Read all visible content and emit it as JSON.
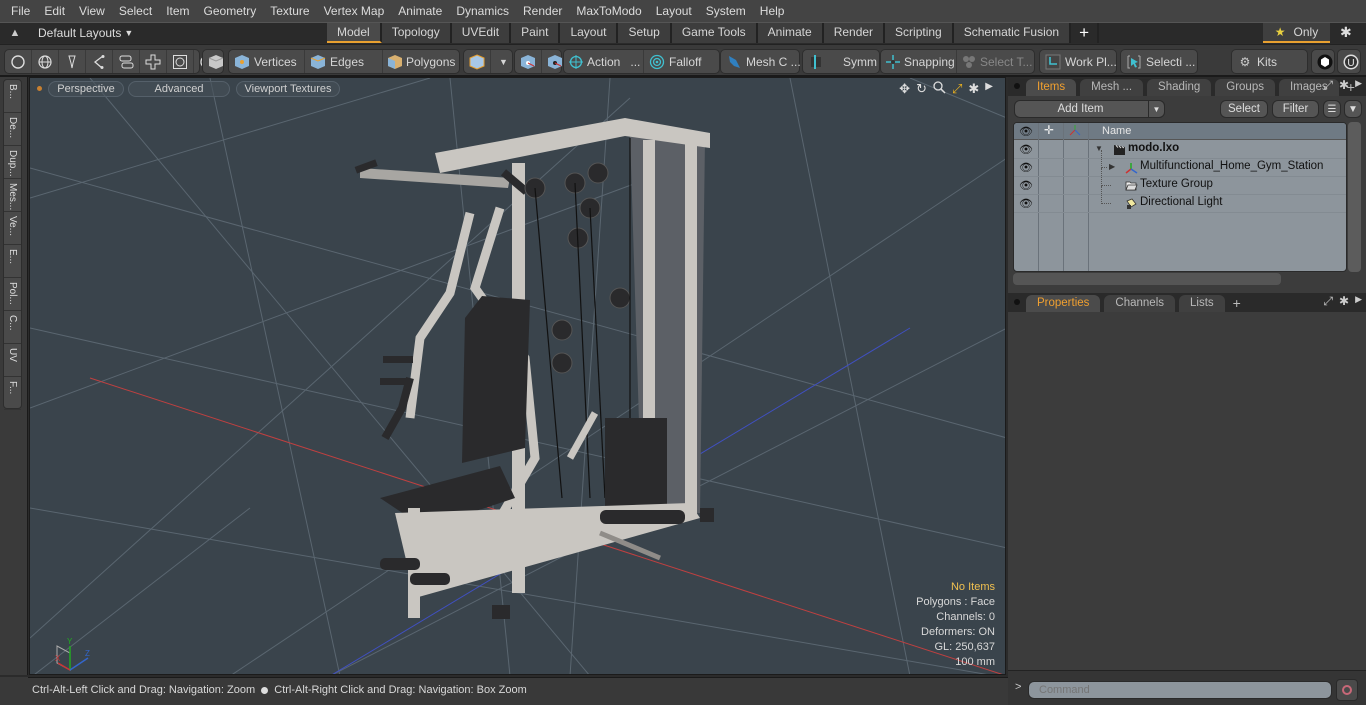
{
  "menubar": {
    "items": [
      "File",
      "Edit",
      "View",
      "Select",
      "Item",
      "Geometry",
      "Texture",
      "Vertex Map",
      "Animate",
      "Dynamics",
      "Render",
      "MaxToModo",
      "Layout",
      "System",
      "Help"
    ]
  },
  "layout_row": {
    "layout_label": "Default Layouts",
    "tabs": [
      {
        "label": "Model",
        "active": true
      },
      {
        "label": "Topology"
      },
      {
        "label": "UVEdit"
      },
      {
        "label": "Paint"
      },
      {
        "label": "Layout"
      },
      {
        "label": "Setup"
      },
      {
        "label": "Game Tools"
      },
      {
        "label": "Animate"
      },
      {
        "label": "Render"
      },
      {
        "label": "Scripting"
      },
      {
        "label": "Schematic Fusion"
      }
    ],
    "add_tab": "+",
    "only_label": "Only"
  },
  "toolbar": {
    "vertices": "Vertices",
    "edges": "Edges",
    "polygons": "Polygons",
    "action": "Action",
    "falloff": "Falloff",
    "mesh_c": "Mesh C ...",
    "symm": "Symm ...",
    "snapping": "Snapping",
    "select_t": "Select T...",
    "work_pl": "Work Pl...",
    "selecti": "Selecti ...",
    "kits": "Kits",
    "ellipsis": "..."
  },
  "left_tabs": [
    "B...",
    "De...",
    "Dup...",
    "Mes...",
    "Ve...",
    "E...",
    "Pol...",
    "C...",
    "UV",
    "F..."
  ],
  "viewport": {
    "perspective": "Perspective",
    "advanced": "Advanced",
    "textures": "Viewport Textures",
    "info": {
      "selection": "No Items",
      "polygons": "Polygons : Face",
      "channels": "Channels: 0",
      "deformers": "Deformers: ON",
      "gl": "GL: 250,637",
      "scale": "100 mm"
    },
    "axis_labels": {
      "x": "X",
      "y": "Y",
      "z": "Z"
    }
  },
  "statusbar": {
    "left": "Ctrl-Alt-Left Click and Drag: Navigation: Zoom",
    "right": "Ctrl-Alt-Right Click and Drag: Navigation: Box Zoom"
  },
  "items_panel": {
    "tabs": [
      {
        "label": "Items",
        "active": true
      },
      {
        "label": "Mesh ..."
      },
      {
        "label": "Shading"
      },
      {
        "label": "Groups"
      },
      {
        "label": "Images"
      }
    ],
    "add_tab": "+",
    "add_item": "Add Item",
    "select": "Select",
    "filter": "Filter",
    "column_name": "Name",
    "rows": [
      {
        "label": "modo.lxo",
        "icon": "scene-icon",
        "bold": true,
        "expanded": true
      },
      {
        "label": "Multifunctional_Home_Gym_Station",
        "icon": "mesh-locator-icon",
        "collapsed_arrow": true
      },
      {
        "label": "Texture Group",
        "icon": "folder-icon"
      },
      {
        "label": "Directional Light",
        "icon": "light-icon"
      }
    ]
  },
  "properties_panel": {
    "tabs": [
      {
        "label": "Properties",
        "active": true
      },
      {
        "label": "Channels"
      },
      {
        "label": "Lists"
      }
    ],
    "add_tab": "+"
  },
  "command": {
    "prompt": ">",
    "placeholder": "Command"
  },
  "colors": {
    "accent": "#e8a030",
    "info_highlight": "#f0c050",
    "viewport_bg": "#3a444c",
    "grid_x_axis": "#c04040",
    "grid_z_axis": "#4050c0"
  }
}
